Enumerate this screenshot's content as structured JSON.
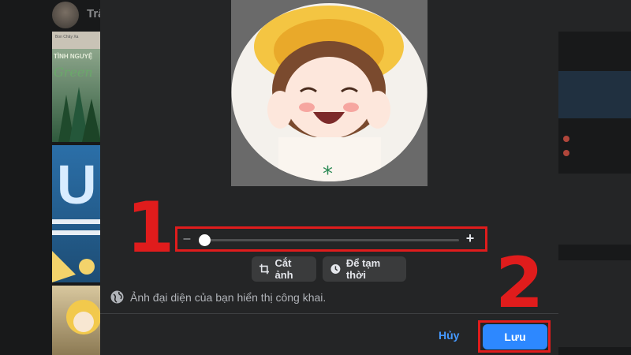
{
  "background": {
    "profile_name": "Trâ",
    "thumb1_caption": "Bon Chây Xa",
    "thumb1_title": "TÌNH NGUYỆ",
    "thumb1_word": "Green",
    "thumb2_letter": "U"
  },
  "editor": {
    "zoom_slider": {
      "minus_symbol": "–",
      "plus_symbol": "+",
      "level": 0.0
    },
    "crop_button": {
      "label": "Cắt ảnh",
      "icon": "crop-icon"
    },
    "temporary_button": {
      "label": "Để tạm thời",
      "icon": "clock-icon"
    },
    "public_note": {
      "text": "Ảnh đại diện của bạn hiển thị công khai.",
      "icon": "globe-icon"
    }
  },
  "footer": {
    "cancel_label": "Hủy",
    "save_label": "Lưu"
  },
  "annotations": {
    "step1": "1",
    "step2": "2",
    "color": "#e01c1c"
  },
  "colors": {
    "accent": "#2d88ff",
    "modal_bg": "#242526",
    "page_bg": "#18191a"
  }
}
